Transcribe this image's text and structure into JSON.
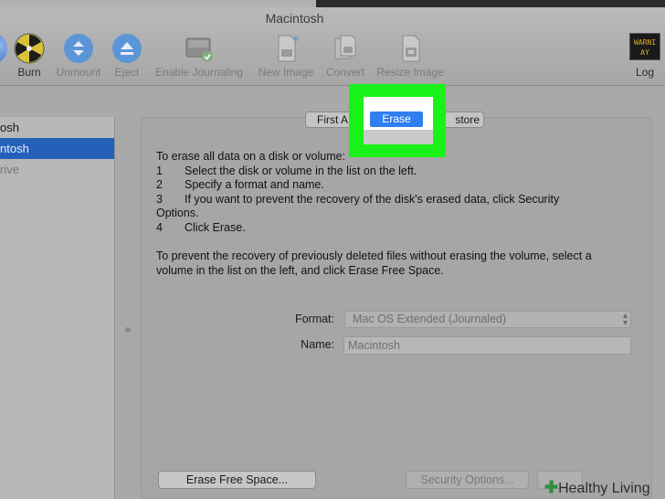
{
  "window": {
    "title": "Macintosh"
  },
  "toolbar": {
    "items": [
      {
        "label": "Burn",
        "icon": "burn-icon",
        "enabled": true
      },
      {
        "label": "Unmount",
        "icon": "unmount-icon",
        "enabled": false
      },
      {
        "label": "Eject",
        "icon": "eject-icon",
        "enabled": false
      },
      {
        "label": "Enable Journaling",
        "icon": "journaling-icon",
        "enabled": false
      },
      {
        "label": "New Image",
        "icon": "new-image-icon",
        "enabled": false
      },
      {
        "label": "Convert",
        "icon": "convert-icon",
        "enabled": false
      },
      {
        "label": "Resize Image",
        "icon": "resize-image-icon",
        "enabled": false
      },
      {
        "label": "Log",
        "icon": "log-icon",
        "enabled": true
      }
    ],
    "log_display": [
      "WARNI",
      "AY 7:36"
    ]
  },
  "sidebar": {
    "items": [
      {
        "label": "osh",
        "state": "normal"
      },
      {
        "label": "ntosh",
        "state": "selected"
      },
      {
        "label": "rive",
        "state": "dimmed"
      }
    ]
  },
  "tabs": {
    "first_aid": "First A",
    "erase": "Erase",
    "restore": "store"
  },
  "instructions": {
    "intro": "To erase all data on a disk or volume:",
    "steps": [
      {
        "num": "1",
        "text": "Select the disk or volume in the list on the left."
      },
      {
        "num": "2",
        "text": "Specify a format and name."
      },
      {
        "num": "3",
        "text": "If you want to prevent the recovery of the disk's erased data, click Security"
      },
      {
        "num": "4",
        "text": "Click Erase."
      }
    ],
    "step3_continued": "Options.",
    "free_space_note": "To prevent the recovery of previously deleted files without erasing the volume, select a volume in the list on the left, and click Erase Free Space."
  },
  "form": {
    "format_label": "Format:",
    "format_value": "Mac OS Extended (Journaled)",
    "name_label": "Name:",
    "name_value": "Macintosh"
  },
  "buttons": {
    "erase_free_space": "Erase Free Space...",
    "security_options": "Security Options..."
  },
  "watermark": {
    "text": "Healthy Living"
  },
  "colors": {
    "highlight": "#19f219",
    "selection": "#2460b8",
    "active_tab": "#2f7ff0"
  }
}
